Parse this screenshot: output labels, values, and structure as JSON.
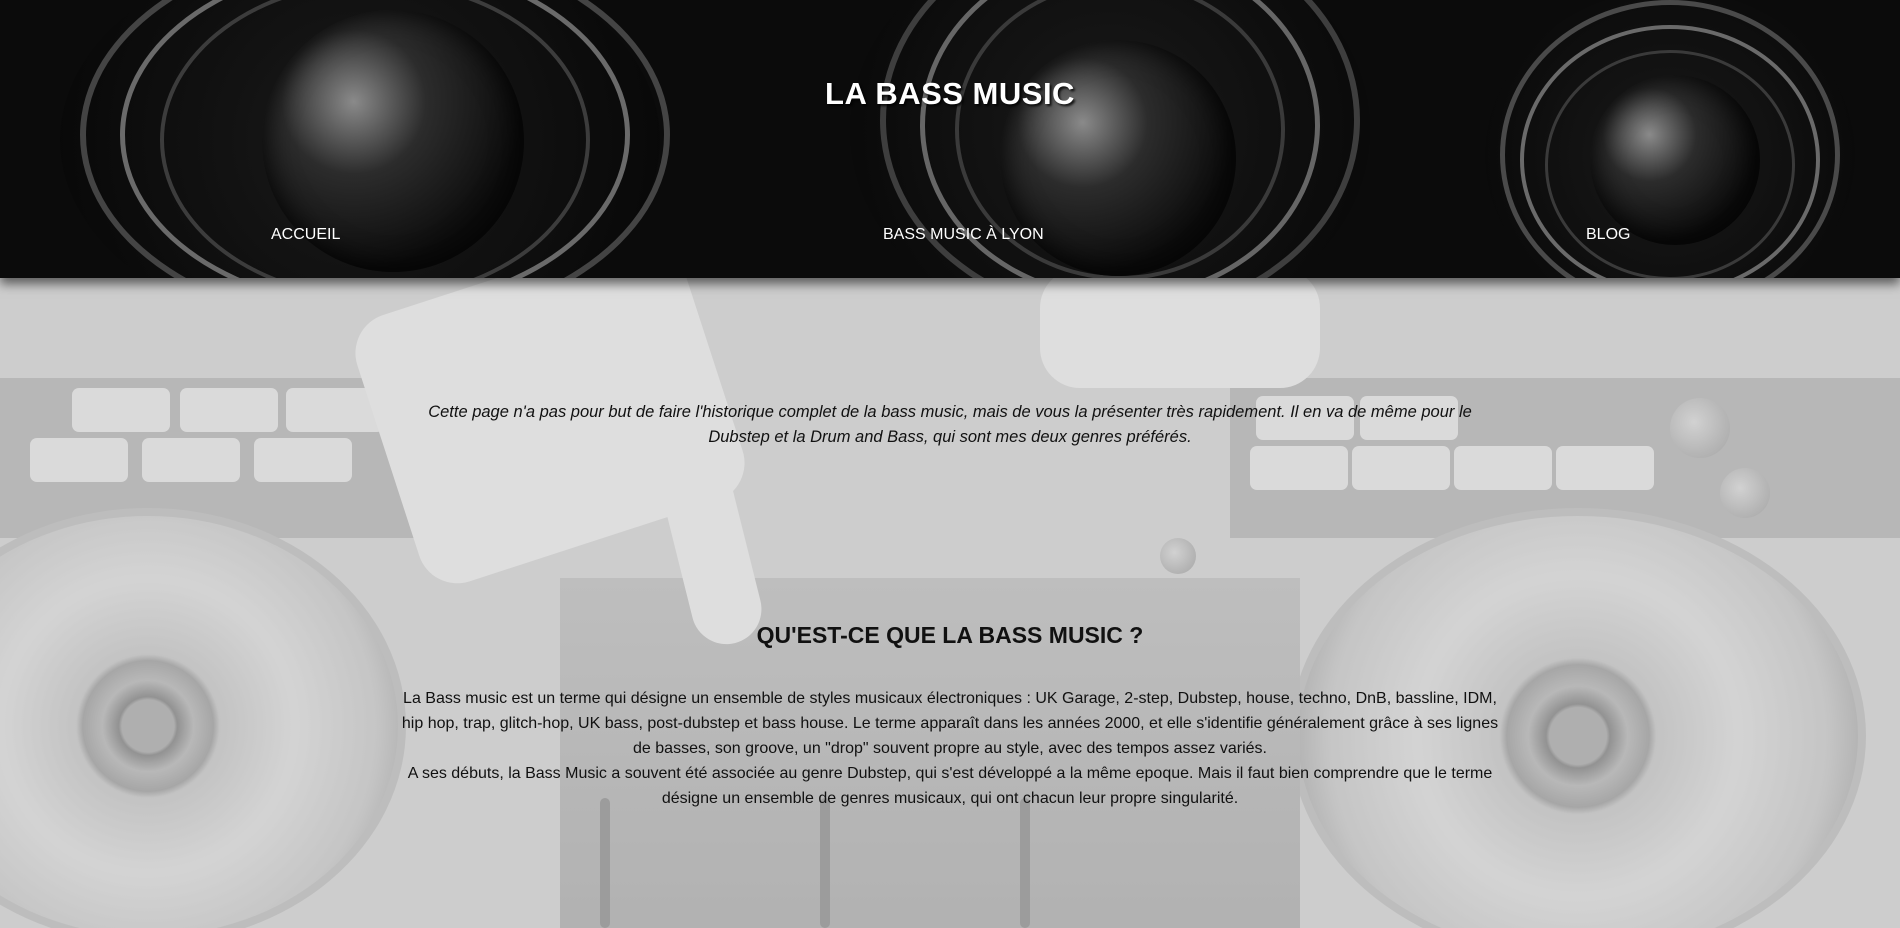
{
  "header": {
    "site_title": "LA BASS MUSIC"
  },
  "nav": {
    "items": [
      {
        "label": "ACCUEIL"
      },
      {
        "label": "BASS MUSIC À LYON"
      },
      {
        "label": "BLOG"
      }
    ]
  },
  "main": {
    "intro": "Cette page n'a pas pour but de faire l'historique complet de la bass music, mais de vous la présenter très rapidement. Il en va de même pour le Dubstep et la Drum and Bass, qui sont mes deux genres préférés.",
    "section_title": "QU'EST-CE QUE LA BASS MUSIC ?",
    "paragraph_1": "La Bass music est un terme qui désigne un ensemble de styles musicaux électroniques : UK Garage, 2-step, Dubstep, house, techno, DnB, bassline, IDM, hip hop, trap, glitch-hop, UK bass, post-dubstep et bass house. Le terme apparaît dans les années 2000, et elle s'identifie généralement grâce à ses lignes de basses, son groove, un \"drop\" souvent propre au style, avec des tempos assez variés.",
    "paragraph_2": "A ses débuts, la Bass Music a souvent été associée au genre Dubstep, qui s'est développé a la même epoque. Mais il faut bien comprendre que le terme désigne un ensemble de genres musicaux, qui ont chacun leur propre singularité."
  }
}
